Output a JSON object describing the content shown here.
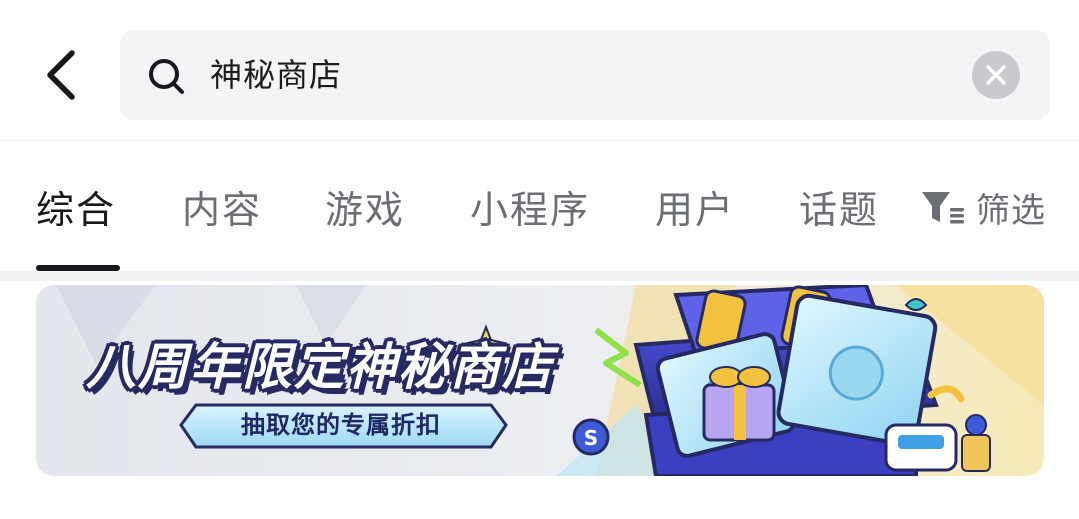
{
  "search": {
    "query": "神秘商店"
  },
  "tabs": [
    {
      "label": "综合",
      "active": true
    },
    {
      "label": "内容",
      "active": false
    },
    {
      "label": "游戏",
      "active": false
    },
    {
      "label": "小程序",
      "active": false
    },
    {
      "label": "用户",
      "active": false
    },
    {
      "label": "话题",
      "active": false
    }
  ],
  "filter": {
    "label": "筛选",
    "icon": "filter-icon"
  },
  "banner": {
    "title": "八周年限定神秘商店",
    "subtitle": "抽取您的专属折扣"
  },
  "icons": {
    "back": "chevron-left-icon",
    "search": "search-icon",
    "clear": "close-icon"
  },
  "colors": {
    "text_primary": "#16181c",
    "text_secondary": "#6b6e73",
    "search_bg": "#f3f4f6",
    "banner_navy": "#272a62"
  }
}
